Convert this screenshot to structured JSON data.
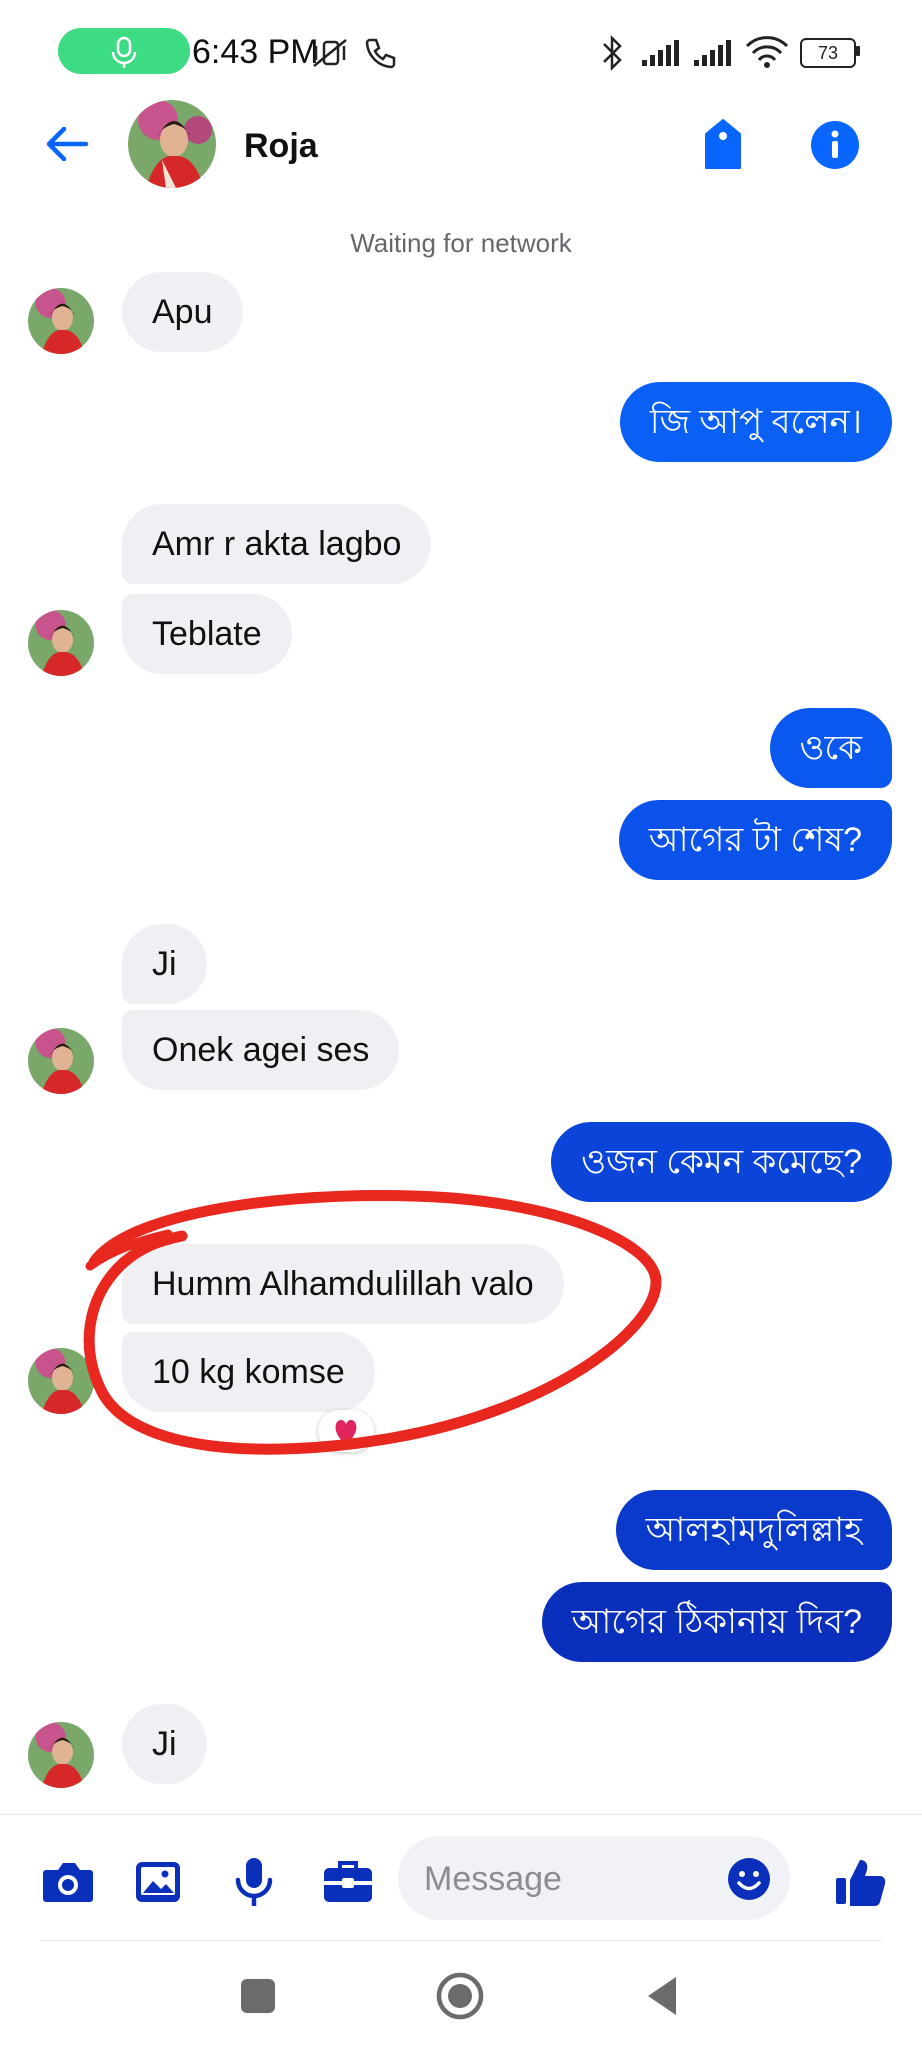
{
  "status_bar": {
    "time": "6:43 PM",
    "battery": "73"
  },
  "header": {
    "name": "Roja"
  },
  "network_status": "Waiting for network",
  "messages": [
    {
      "from": "them",
      "text": "Apu"
    },
    {
      "from": "me",
      "text": "জি আপু বলেন।"
    },
    {
      "from": "them",
      "text": "Amr r akta lagbo"
    },
    {
      "from": "them",
      "text": "Teblate"
    },
    {
      "from": "me",
      "text": "ওকে"
    },
    {
      "from": "me",
      "text": "আগের টা শেষ?"
    },
    {
      "from": "them",
      "text": "Ji"
    },
    {
      "from": "them",
      "text": "Onek agei ses"
    },
    {
      "from": "me",
      "text": "ওজন কেমন কমেছে?"
    },
    {
      "from": "them",
      "text": "Humm Alhamdulillah valo"
    },
    {
      "from": "them",
      "text": "10 kg komse",
      "reaction": "heart"
    },
    {
      "from": "me",
      "text": "আলহামদুলিল্লাহ"
    },
    {
      "from": "me",
      "text": "আগের ঠিকানায় দিব?"
    },
    {
      "from": "them",
      "text": "Ji"
    }
  ],
  "composer": {
    "placeholder": "Message"
  },
  "colors": {
    "accent": "#0866ff",
    "out_top": "#0a5bf5",
    "out_bottom": "#0b2fbd",
    "in_bubble": "#eef0f3",
    "annotation": "#e8271f"
  },
  "icons": [
    "back-arrow-icon",
    "tag-icon",
    "info-icon",
    "camera-icon",
    "image-icon",
    "mic-icon",
    "toolbox-icon",
    "emoji-icon",
    "thumbs-up-icon",
    "heart-icon",
    "square-icon",
    "home-circle-icon",
    "back-triangle-icon"
  ]
}
